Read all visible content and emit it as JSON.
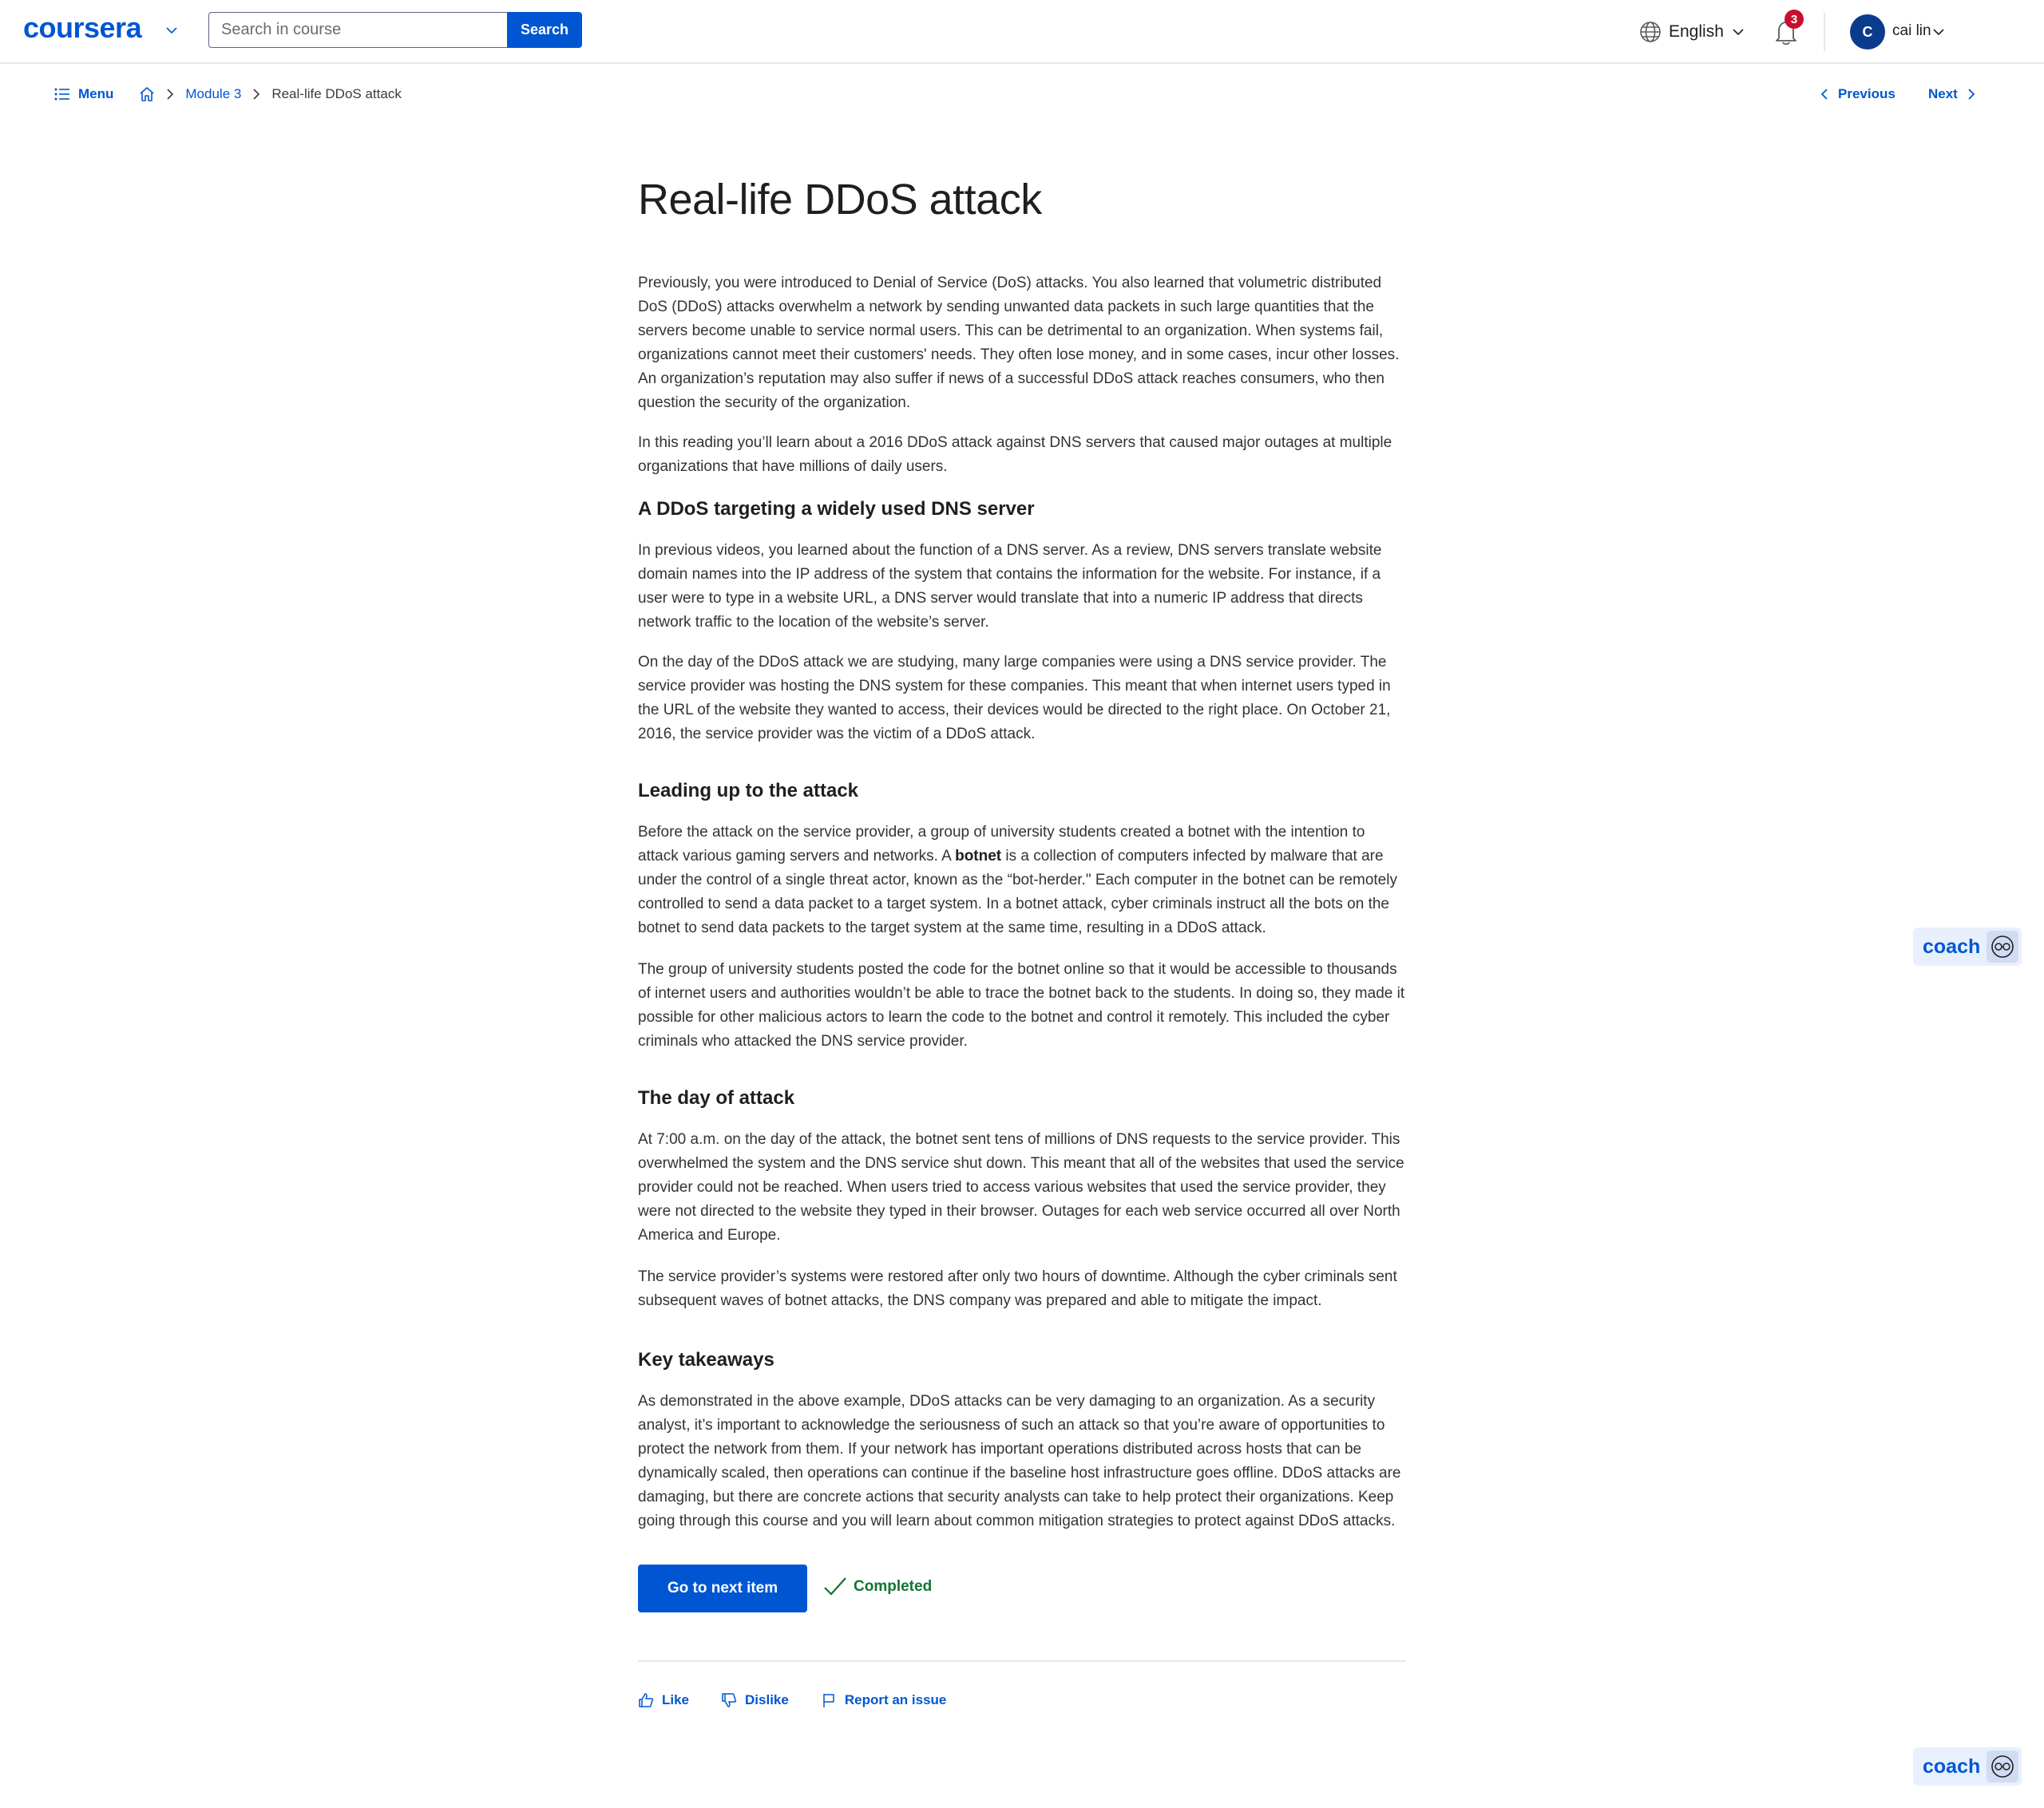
{
  "header": {
    "logo": "coursera",
    "search": {
      "placeholder": "Search in course",
      "value": "",
      "button_label": "Search"
    },
    "language": "English",
    "notifications_count": "3",
    "user": {
      "initial": "C",
      "name": "cai lin"
    }
  },
  "nav": {
    "menu_label": "Menu",
    "breadcrumb": [
      "Module 3",
      "Real-life DDoS attack"
    ],
    "previous_label": "Previous",
    "next_label": "Next"
  },
  "article": {
    "title": "Real-life DDoS attack",
    "intro": [
      "Previously, you were introduced to Denial of Service (DoS) attacks. You also learned that volumetric distributed DoS (DDoS) attacks overwhelm a network by sending unwanted data packets in such large quantities that the servers become unable to service normal users. This can be detrimental to an organization. When systems fail, organizations cannot meet their customers' needs. They often lose money, and in some cases, incur other losses. An organization’s reputation may also suffer if news of a successful DDoS attack reaches consumers, who then question the security of the organization.",
      "In this reading you’ll learn about a 2016 DDoS attack against DNS servers that caused major outages at multiple organizations that have millions of daily users."
    ],
    "sections": [
      {
        "heading": "A DDoS targeting a widely used DNS server",
        "paragraphs": [
          "In previous videos, you learned about the function of a DNS server. As a review, DNS servers translate website domain names into the IP address of the system that contains the information for the website. For instance, if a user were to type in a website URL, a DNS server would translate that into a numeric IP address that directs network traffic to the location of the website’s server.",
          "On the day of the DDoS attack we are studying, many large companies were using a DNS service provider. The service provider was hosting the DNS system for these companies. This meant that when internet users typed in the URL of the website they wanted to access, their devices would be directed to the right place. On October 21, 2016, the service provider was the victim of a DDoS attack."
        ]
      },
      {
        "heading": "Leading up to the attack",
        "p1_before": "Before the attack on the service provider, a group of university students created a botnet with the intention to attack various gaming servers and networks. A ",
        "p1_bold": "botnet",
        "p1_after": " is a collection of computers infected by malware that are under the control of a single threat actor, known as the “bot-herder.\" Each computer in the botnet can be remotely controlled to send a data packet to a target system. In a botnet attack, cyber criminals instruct all the bots on the botnet to send data packets to the target system at the same time, resulting in a DDoS attack.",
        "p2": "The group of university students posted the code for the botnet online so that it would be accessible to thousands of internet users and authorities wouldn’t be able to trace the botnet back to the students. In doing so, they made it possible for other malicious actors to learn the code to the botnet and control it remotely. This included the cyber criminals who attacked the DNS service provider."
      },
      {
        "heading": "The day of attack",
        "paragraphs": [
          "At 7:00 a.m. on the day of the attack, the botnet sent tens of millions of DNS requests to the service provider. This overwhelmed the system and the DNS service shut down. This meant that all of the websites that used the service provider could not be reached. When users tried to access various websites that used the service provider, they were not directed to the website they typed in their browser. Outages for each web service occurred all over North America and Europe.",
          "The service provider’s systems were restored after only two hours of downtime. Although the cyber criminals sent subsequent waves of botnet attacks, the DNS company was prepared and able to mitigate the impact."
        ]
      },
      {
        "heading": "Key takeaways",
        "paragraphs": [
          "As demonstrated in the above example, DDoS attacks can be very damaging to an organization. As a security analyst, it’s important to acknowledge the seriousness of such an attack so that you’re aware of opportunities to protect the network from them. If your network has important operations distributed across hosts that can be dynamically scaled, then operations can continue if the baseline host infrastructure goes offline. DDoS attacks are damaging, but there are concrete actions that security analysts can take to help protect their organizations. Keep going through this course and you will learn about common mitigation strategies to protect against DDoS attacks."
        ]
      }
    ]
  },
  "actions": {
    "next_item_label": "Go to next item",
    "completed_label": "Completed",
    "like_label": "Like",
    "dislike_label": "Dislike",
    "report_label": "Report an issue"
  },
  "coach": {
    "label": "coach"
  },
  "colors": {
    "accent": "#0056d2",
    "completed": "#137333",
    "badge": "#c8102e",
    "avatar": "#0b3b8c"
  }
}
